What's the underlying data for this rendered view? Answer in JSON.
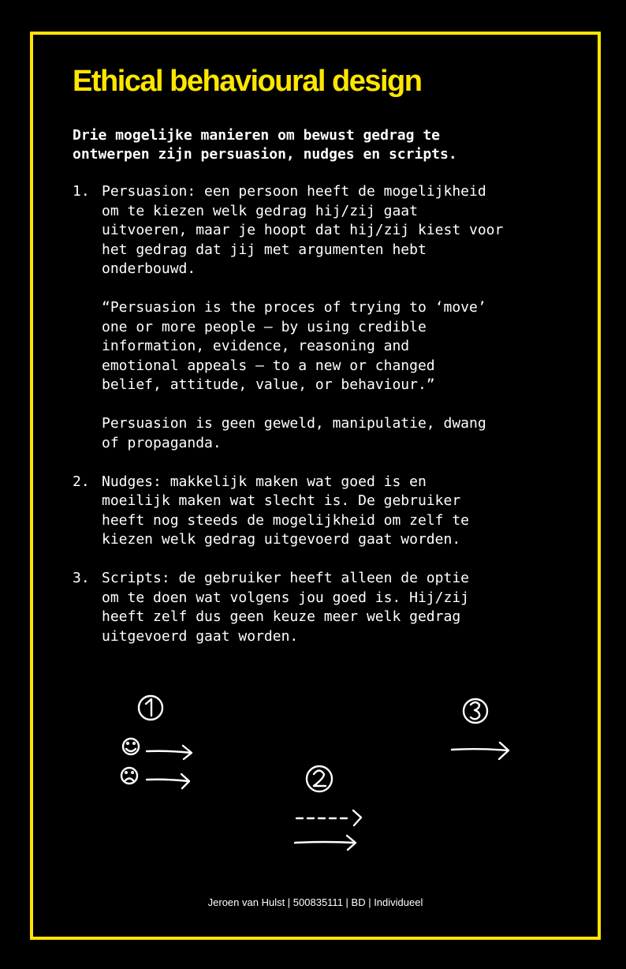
{
  "title": "Ethical behavioural design",
  "intro": "Drie mogelijke manieren om bewust gedrag te\nontwerpen zijn persuasion, nudges en scripts.",
  "items": [
    {
      "number": "1.",
      "paragraphs": [
        "Persuasion: een persoon heeft de mogelijkheid\nom te kiezen welk gedrag hij/zij gaat\nuitvoeren, maar je hoopt dat hij/zij kiest voor\nhet gedrag dat jij met argumenten hebt\nonderbouwd.",
        "“Persuasion is the proces of trying to ‘move’\none or more people – by using credible\ninformation, evidence, reasoning and\nemotional appeals – to a new or changed\nbelief, attitude, value, or behaviour.”",
        "Persuasion is geen geweld, manipulatie, dwang\nof propaganda."
      ]
    },
    {
      "number": "2.",
      "paragraphs": [
        "Nudges: makkelijk maken wat goed is en\nmoeilijk maken wat slecht is. De gebruiker\nheeft nog steeds de mogelijkheid om zelf te\nkiezen welk gedrag uitgevoerd gaat worden."
      ]
    },
    {
      "number": "3.",
      "paragraphs": [
        "Scripts: de gebruiker heeft alleen de optie\nom te doen wat volgens jou goed is. Hij/zij\nheeft zelf dus geen keuze meer welk gedrag\nuitgevoerd gaat worden."
      ]
    }
  ],
  "sketch": {
    "labels": [
      "1",
      "2",
      "3"
    ],
    "icons": [
      "smiley-icon",
      "sad-face-icon",
      "solid-arrow-icon",
      "dashed-arrow-icon"
    ]
  },
  "footer": "Jeroen van Hulst | 500835111 | BD | Individueel",
  "colors": {
    "background": "#000000",
    "accent": "#ffe600",
    "text": "#ffffff"
  }
}
